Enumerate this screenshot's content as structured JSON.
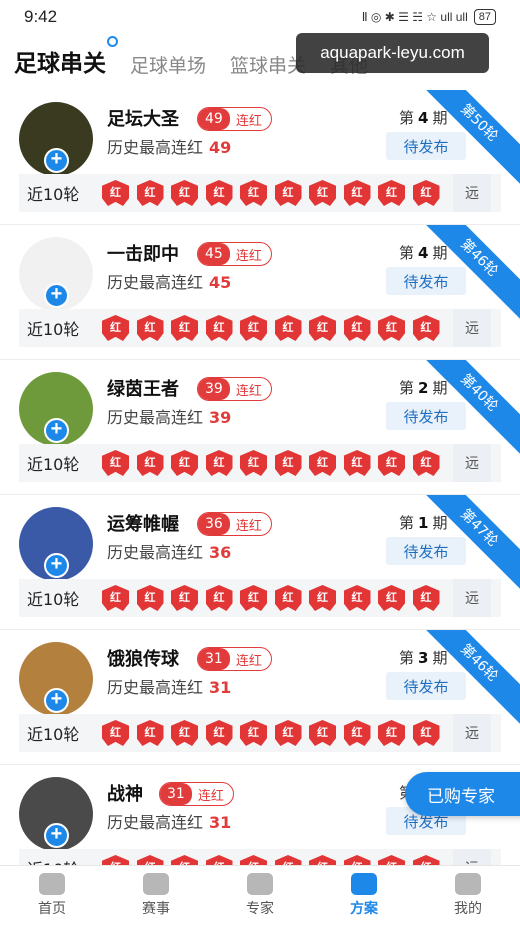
{
  "status": {
    "time": "9:42",
    "battery": "87",
    "signal": "Ⅱ ◎ ✱ ☰ ☵ ☆ ull ull"
  },
  "tabs": [
    {
      "label": "足球串关",
      "active": true
    },
    {
      "label": "足球单场",
      "active": false
    },
    {
      "label": "篮球串关",
      "active": false
    },
    {
      "label": "其他",
      "active": false
    }
  ],
  "watermark": "aquapark-leyu.com",
  "recent_label": "近10轮",
  "more_label": "远",
  "history_label": "历史最高连红",
  "streak_suffix": "连红",
  "issue_prefix": "第",
  "issue_suffix": "期",
  "pending_label": "待发布",
  "mark_label": "红",
  "experts": [
    {
      "name": "足坛大圣",
      "streak": "49",
      "best": "49",
      "issue": "4",
      "ribbon": "第50轮",
      "avatar_color": "#3a3a20",
      "marks": [
        "红",
        "红",
        "红",
        "红",
        "红",
        "红",
        "红",
        "红",
        "红",
        "红"
      ]
    },
    {
      "name": "一击即中",
      "streak": "45",
      "best": "45",
      "issue": "4",
      "ribbon": "第46轮",
      "avatar_color": "#f1f1f1",
      "marks": [
        "红",
        "红",
        "红",
        "红",
        "红",
        "红",
        "红",
        "红",
        "红",
        "红"
      ]
    },
    {
      "name": "绿茵王者",
      "streak": "39",
      "best": "39",
      "issue": "2",
      "ribbon": "第40轮",
      "avatar_color": "#6f9a3c",
      "marks": [
        "红",
        "红",
        "红",
        "红",
        "红",
        "红",
        "红",
        "红",
        "红",
        "红"
      ]
    },
    {
      "name": "运筹帷幄",
      "streak": "36",
      "best": "36",
      "issue": "1",
      "ribbon": "第47轮",
      "avatar_color": "#3a5aa8",
      "marks": [
        "红",
        "红",
        "红",
        "红",
        "红",
        "红",
        "红",
        "红",
        "红",
        "红"
      ]
    },
    {
      "name": "饿狼传球",
      "streak": "31",
      "best": "31",
      "issue": "3",
      "ribbon": "第46轮",
      "avatar_color": "#b4803e",
      "marks": [
        "红",
        "红",
        "红",
        "红",
        "红",
        "红",
        "红",
        "红",
        "红",
        "红"
      ]
    },
    {
      "name": "战神",
      "streak": "31",
      "best": "31",
      "issue": "3",
      "ribbon": "",
      "avatar_color": "#4a4a4a",
      "marks": [
        "红",
        "红",
        "红",
        "红",
        "红",
        "红",
        "红",
        "红",
        "红",
        "红"
      ]
    }
  ],
  "bought_label": "已购专家",
  "nav": [
    {
      "label": "首页",
      "active": false
    },
    {
      "label": "赛事",
      "active": false
    },
    {
      "label": "专家",
      "active": false
    },
    {
      "label": "方案",
      "active": true
    },
    {
      "label": "我的",
      "active": false
    }
  ]
}
